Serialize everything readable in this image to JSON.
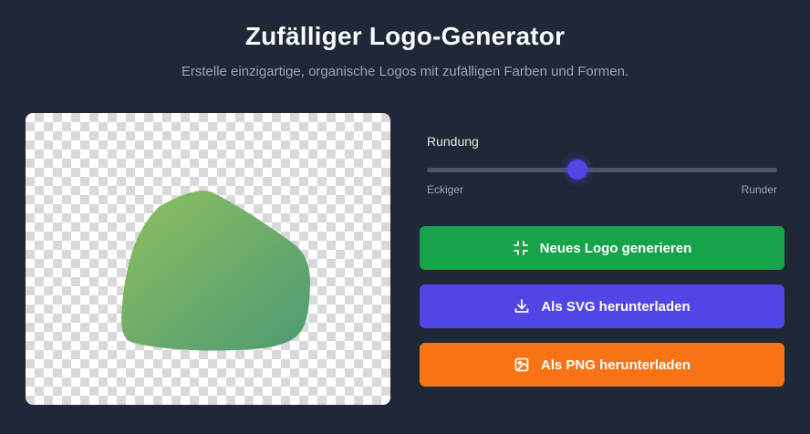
{
  "header": {
    "title": "Zufälliger Logo-Generator",
    "subtitle": "Erstelle einzigartige, organische Logos mit zufälligen Farben und Formen."
  },
  "preview": {
    "logo_colors": [
      "#8fbf60",
      "#4d9a73"
    ]
  },
  "rounding": {
    "label": "Rundung",
    "value_fraction": 0.43,
    "min_label": "Eckiger",
    "max_label": "Runder"
  },
  "buttons": {
    "generate": {
      "label": "Neues Logo generieren",
      "icon": "shrink-arrows-icon",
      "color": "#17a34a"
    },
    "download_svg": {
      "label": "Als SVG herunterladen",
      "icon": "download-icon",
      "color": "#5046e5"
    },
    "download_png": {
      "label": "Als PNG herunterladen",
      "icon": "image-icon",
      "color": "#f87315"
    }
  }
}
